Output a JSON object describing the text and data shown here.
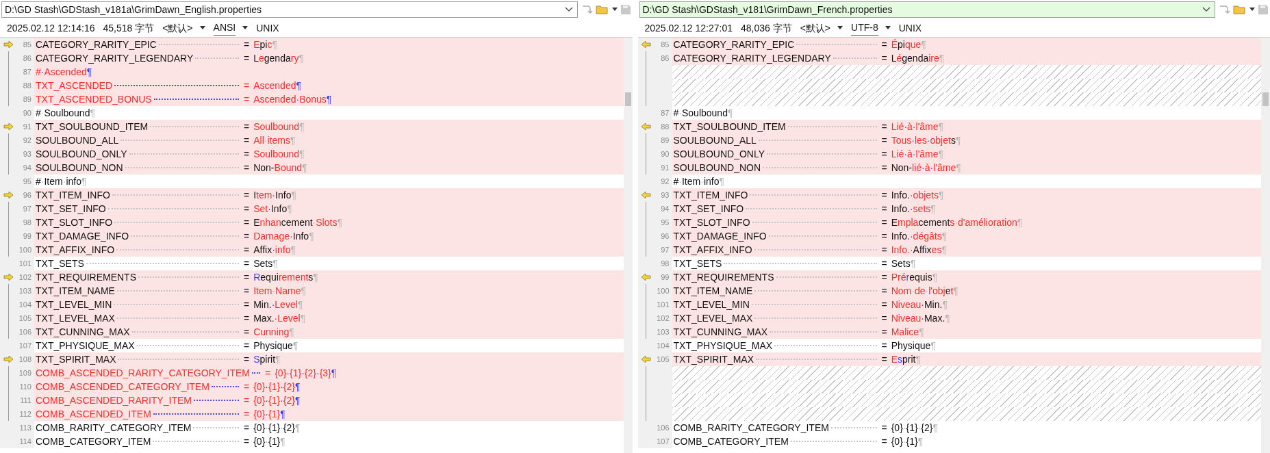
{
  "panes": [
    {
      "path": "D:\\GD Stash\\GDStash_v181a\\GrimDawn_English.properties",
      "path_highlighted": false,
      "date": "2025.02.12 12:14:16",
      "size": "45,518 字节",
      "codepage": "<默认>",
      "encoding": "ANSI",
      "encoding_highlighted": true,
      "eol": "UNIX",
      "lines": [
        {
          "kind": "changed",
          "arrow": true,
          "number": "85",
          "key": [
            {
              "text": "CATEGORY_RARITY_EPIC",
              "kind": "plain"
            }
          ],
          "value": [
            {
              "text": "=",
              "kind": "plain"
            },
            {
              "text": "E",
              "kind": "changed"
            },
            {
              "text": "pi",
              "kind": "plain"
            },
            {
              "text": "c",
              "kind": "changed"
            },
            {
              "text": "¶",
              "kind": "marker"
            }
          ]
        },
        {
          "kind": "changed",
          "arrow": false,
          "number": "86",
          "key": [
            {
              "text": "CATEGORY_RARITY_LEGENDARY",
              "kind": "plain"
            }
          ],
          "value": [
            {
              "text": "=",
              "kind": "plain"
            },
            {
              "text": "L",
              "kind": "plain"
            },
            {
              "text": "e",
              "kind": "changed"
            },
            {
              "text": "genda",
              "kind": "plain"
            },
            {
              "text": "ry",
              "kind": "changed"
            },
            {
              "text": "¶",
              "kind": "marker"
            }
          ]
        },
        {
          "kind": "added",
          "arrow": false,
          "number": "87",
          "key": [
            {
              "text": "#",
              "kind": "changed"
            },
            {
              "text": "·",
              "kind": "moved"
            },
            {
              "text": "Ascended",
              "kind": "changed"
            },
            {
              "text": "¶",
              "kind": "moved"
            }
          ]
        },
        {
          "kind": "added",
          "arrow": false,
          "number": "88",
          "key": [
            {
              "text": "TXT_ASCENDED",
              "kind": "changed"
            }
          ],
          "value": [
            {
              "text": "=",
              "kind": "changed"
            },
            {
              "text": "Ascended",
              "kind": "changed"
            },
            {
              "text": "¶",
              "kind": "moved"
            }
          ]
        },
        {
          "kind": "added",
          "arrow": false,
          "number": "89",
          "key": [
            {
              "text": "TXT_ASCENDED_BONUS",
              "kind": "changed"
            }
          ],
          "value": [
            {
              "text": "=",
              "kind": "changed"
            },
            {
              "text": "Ascended",
              "kind": "changed"
            },
            {
              "text": "·",
              "kind": "moved"
            },
            {
              "text": "Bonus",
              "kind": "changed"
            },
            {
              "text": "¶",
              "kind": "moved"
            }
          ]
        },
        {
          "kind": "equal",
          "arrow": false,
          "number": "90",
          "key": [
            {
              "text": "#",
              "kind": "plain"
            },
            {
              "text": "·",
              "kind": "marker"
            },
            {
              "text": "Soulbound",
              "kind": "plain"
            },
            {
              "text": "¶",
              "kind": "marker"
            }
          ]
        },
        {
          "kind": "changed",
          "arrow": true,
          "number": "91",
          "key": [
            {
              "text": "TXT_SOULBOUND_ITEM",
              "kind": "plain"
            }
          ],
          "value": [
            {
              "text": "=",
              "kind": "plain"
            },
            {
              "text": "Soulbound",
              "kind": "changed"
            },
            {
              "text": "¶",
              "kind": "marker"
            }
          ]
        },
        {
          "kind": "changed",
          "arrow": false,
          "number": "92",
          "key": [
            {
              "text": "SOULBOUND_ALL",
              "kind": "plain"
            }
          ],
          "value": [
            {
              "text": "=",
              "kind": "plain"
            },
            {
              "text": "All",
              "kind": "changed"
            },
            {
              "text": "·",
              "kind": "marker"
            },
            {
              "text": "items",
              "kind": "changed"
            },
            {
              "text": "¶",
              "kind": "marker"
            }
          ]
        },
        {
          "kind": "changed",
          "arrow": false,
          "number": "93",
          "key": [
            {
              "text": "SOULBOUND_ONLY",
              "kind": "plain"
            }
          ],
          "value": [
            {
              "text": "=",
              "kind": "plain"
            },
            {
              "text": "Soulbound",
              "kind": "changed"
            },
            {
              "text": "¶",
              "kind": "marker"
            }
          ]
        },
        {
          "kind": "changed",
          "arrow": false,
          "number": "94",
          "key": [
            {
              "text": "SOULBOUND_NON",
              "kind": "plain"
            }
          ],
          "value": [
            {
              "text": "=",
              "kind": "plain"
            },
            {
              "text": "Non-",
              "kind": "plain"
            },
            {
              "text": "Bound",
              "kind": "changed"
            },
            {
              "text": "¶",
              "kind": "marker"
            }
          ]
        },
        {
          "kind": "equal",
          "arrow": false,
          "number": "95",
          "key": [
            {
              "text": "#",
              "kind": "plain"
            },
            {
              "text": "·",
              "kind": "marker"
            },
            {
              "text": "Item",
              "kind": "plain"
            },
            {
              "text": "·",
              "kind": "marker"
            },
            {
              "text": "info",
              "kind": "plain"
            },
            {
              "text": "¶",
              "kind": "marker"
            }
          ]
        },
        {
          "kind": "changed",
          "arrow": true,
          "number": "96",
          "key": [
            {
              "text": "TXT_ITEM_INFO",
              "kind": "plain"
            }
          ],
          "value": [
            {
              "text": "=",
              "kind": "plain"
            },
            {
              "text": "I",
              "kind": "plain"
            },
            {
              "text": "tem",
              "kind": "changed"
            },
            {
              "text": "·",
              "kind": "moved"
            },
            {
              "text": "Info",
              "kind": "plain"
            },
            {
              "text": "¶",
              "kind": "marker"
            }
          ]
        },
        {
          "kind": "changed",
          "arrow": false,
          "number": "97",
          "key": [
            {
              "text": "TXT_SET_INFO",
              "kind": "plain"
            }
          ],
          "value": [
            {
              "text": "=",
              "kind": "plain"
            },
            {
              "text": "Set",
              "kind": "changed"
            },
            {
              "text": "·",
              "kind": "moved"
            },
            {
              "text": "Info",
              "kind": "plain"
            },
            {
              "text": "¶",
              "kind": "marker"
            }
          ]
        },
        {
          "kind": "changed",
          "arrow": false,
          "number": "98",
          "key": [
            {
              "text": "TXT_SLOT_INFO",
              "kind": "plain"
            }
          ],
          "value": [
            {
              "text": "=",
              "kind": "plain"
            },
            {
              "text": "E",
              "kind": "plain"
            },
            {
              "text": "nhan",
              "kind": "changed"
            },
            {
              "text": "cement",
              "kind": "plain"
            },
            {
              "text": "·",
              "kind": "marker"
            },
            {
              "text": "Slots",
              "kind": "changed"
            },
            {
              "text": "¶",
              "kind": "marker"
            }
          ]
        },
        {
          "kind": "changed",
          "arrow": false,
          "number": "99",
          "key": [
            {
              "text": "TXT_DAMAGE_INFO",
              "kind": "plain"
            }
          ],
          "value": [
            {
              "text": "=",
              "kind": "plain"
            },
            {
              "text": "Damage",
              "kind": "changed"
            },
            {
              "text": "·",
              "kind": "moved"
            },
            {
              "text": "Info",
              "kind": "plain"
            },
            {
              "text": "¶",
              "kind": "marker"
            }
          ]
        },
        {
          "kind": "changed",
          "arrow": false,
          "number": "100",
          "key": [
            {
              "text": "TXT_AFFIX_INFO",
              "kind": "plain"
            }
          ],
          "value": [
            {
              "text": "=",
              "kind": "plain"
            },
            {
              "text": "Affix",
              "kind": "plain"
            },
            {
              "text": "·",
              "kind": "moved"
            },
            {
              "text": "info",
              "kind": "changed"
            },
            {
              "text": "¶",
              "kind": "marker"
            }
          ]
        },
        {
          "kind": "equal",
          "arrow": false,
          "number": "101",
          "key": [
            {
              "text": "TXT_SETS",
              "kind": "plain"
            }
          ],
          "value": [
            {
              "text": "=",
              "kind": "plain"
            },
            {
              "text": "Sets",
              "kind": "plain"
            },
            {
              "text": "¶",
              "kind": "marker"
            }
          ]
        },
        {
          "kind": "changed",
          "arrow": true,
          "number": "102",
          "key": [
            {
              "text": "TXT_REQUIREMENTS",
              "kind": "plain"
            }
          ],
          "value": [
            {
              "text": "=",
              "kind": "plain"
            },
            {
              "text": "R",
              "kind": "moved"
            },
            {
              "text": "equi",
              "kind": "plain"
            },
            {
              "text": "rement",
              "kind": "changed"
            },
            {
              "text": "s",
              "kind": "plain"
            },
            {
              "text": "¶",
              "kind": "marker"
            }
          ]
        },
        {
          "kind": "changed",
          "arrow": false,
          "number": "103",
          "key": [
            {
              "text": "TXT_ITEM_NAME",
              "kind": "plain"
            }
          ],
          "value": [
            {
              "text": "=",
              "kind": "plain"
            },
            {
              "text": "Item",
              "kind": "changed"
            },
            {
              "text": "·",
              "kind": "marker"
            },
            {
              "text": "Name",
              "kind": "changed"
            },
            {
              "text": "¶",
              "kind": "marker"
            }
          ]
        },
        {
          "kind": "changed",
          "arrow": false,
          "number": "104",
          "key": [
            {
              "text": "TXT_LEVEL_MIN",
              "kind": "plain"
            }
          ],
          "value": [
            {
              "text": "=",
              "kind": "plain"
            },
            {
              "text": "Min.",
              "kind": "plain"
            },
            {
              "text": "·",
              "kind": "moved"
            },
            {
              "text": "Level",
              "kind": "changed"
            },
            {
              "text": "¶",
              "kind": "marker"
            }
          ]
        },
        {
          "kind": "changed",
          "arrow": false,
          "number": "105",
          "key": [
            {
              "text": "TXT_LEVEL_MAX",
              "kind": "plain"
            }
          ],
          "value": [
            {
              "text": "=",
              "kind": "plain"
            },
            {
              "text": "Max.",
              "kind": "plain"
            },
            {
              "text": "·",
              "kind": "moved"
            },
            {
              "text": "Level",
              "kind": "changed"
            },
            {
              "text": "¶",
              "kind": "marker"
            }
          ]
        },
        {
          "kind": "changed",
          "arrow": false,
          "number": "106",
          "key": [
            {
              "text": "TXT_CUNNING_MAX",
              "kind": "plain"
            }
          ],
          "value": [
            {
              "text": "=",
              "kind": "plain"
            },
            {
              "text": "Cunning",
              "kind": "changed"
            },
            {
              "text": "¶",
              "kind": "marker"
            }
          ]
        },
        {
          "kind": "equal",
          "arrow": false,
          "number": "107",
          "key": [
            {
              "text": "TXT_PHYSIQUE_MAX",
              "kind": "plain"
            }
          ],
          "value": [
            {
              "text": "=",
              "kind": "plain"
            },
            {
              "text": "Physique",
              "kind": "plain"
            },
            {
              "text": "¶",
              "kind": "marker"
            }
          ]
        },
        {
          "kind": "changed",
          "arrow": true,
          "number": "108",
          "key": [
            {
              "text": "TXT_SPIRIT_MAX",
              "kind": "plain"
            }
          ],
          "value": [
            {
              "text": "=",
              "kind": "plain"
            },
            {
              "text": "S",
              "kind": "moved"
            },
            {
              "text": "pirit",
              "kind": "plain"
            },
            {
              "text": "¶",
              "kind": "marker"
            }
          ]
        },
        {
          "kind": "added",
          "arrow": false,
          "number": "109",
          "key": [
            {
              "text": "COMB_ASCENDED_RARITY_CATEGORY_ITEM",
              "kind": "changed"
            }
          ],
          "value": [
            {
              "text": "=",
              "kind": "changed"
            },
            {
              "text": "{0}",
              "kind": "changed"
            },
            {
              "text": "·",
              "kind": "moved"
            },
            {
              "text": "{1}",
              "kind": "changed"
            },
            {
              "text": "·",
              "kind": "moved"
            },
            {
              "text": "{2}",
              "kind": "changed"
            },
            {
              "text": "·",
              "kind": "moved"
            },
            {
              "text": "{3}",
              "kind": "changed"
            },
            {
              "text": "¶",
              "kind": "moved"
            }
          ]
        },
        {
          "kind": "added",
          "arrow": false,
          "number": "110",
          "key": [
            {
              "text": "COMB_ASCENDED_CATEGORY_ITEM",
              "kind": "changed"
            }
          ],
          "value": [
            {
              "text": "=",
              "kind": "changed"
            },
            {
              "text": "{0}",
              "kind": "changed"
            },
            {
              "text": "·",
              "kind": "moved"
            },
            {
              "text": "{1}",
              "kind": "changed"
            },
            {
              "text": "·",
              "kind": "moved"
            },
            {
              "text": "{2}",
              "kind": "changed"
            },
            {
              "text": "¶",
              "kind": "moved"
            }
          ]
        },
        {
          "kind": "added",
          "arrow": false,
          "number": "111",
          "key": [
            {
              "text": "COMB_ASCENDED_RARITY_ITEM",
              "kind": "changed"
            }
          ],
          "value": [
            {
              "text": "=",
              "kind": "changed"
            },
            {
              "text": "{0}",
              "kind": "changed"
            },
            {
              "text": "·",
              "kind": "moved"
            },
            {
              "text": "{1}",
              "kind": "changed"
            },
            {
              "text": "·",
              "kind": "moved"
            },
            {
              "text": "{2}",
              "kind": "changed"
            },
            {
              "text": "¶",
              "kind": "moved"
            }
          ]
        },
        {
          "kind": "added",
          "arrow": false,
          "number": "112",
          "key": [
            {
              "text": "COMB_ASCENDED_ITEM",
              "kind": "changed"
            }
          ],
          "value": [
            {
              "text": "=",
              "kind": "changed"
            },
            {
              "text": "{0}",
              "kind": "changed"
            },
            {
              "text": "·",
              "kind": "moved"
            },
            {
              "text": "{1}",
              "kind": "changed"
            },
            {
              "text": "¶",
              "kind": "moved"
            }
          ]
        },
        {
          "kind": "equal",
          "arrow": false,
          "number": "113",
          "key": [
            {
              "text": "COMB_RARITY_CATEGORY_ITEM",
              "kind": "plain"
            }
          ],
          "value": [
            {
              "text": "=",
              "kind": "plain"
            },
            {
              "text": "{0}",
              "kind": "plain"
            },
            {
              "text": "·",
              "kind": "marker"
            },
            {
              "text": "{1}",
              "kind": "plain"
            },
            {
              "text": "·",
              "kind": "marker"
            },
            {
              "text": "{2}",
              "kind": "plain"
            },
            {
              "text": "¶",
              "kind": "marker"
            }
          ]
        },
        {
          "kind": "equal",
          "arrow": false,
          "number": "114",
          "key": [
            {
              "text": "COMB_CATEGORY_ITEM",
              "kind": "plain"
            }
          ],
          "value": [
            {
              "text": "=",
              "kind": "plain"
            },
            {
              "text": "{0}",
              "kind": "plain"
            },
            {
              "text": "·",
              "kind": "marker"
            },
            {
              "text": "{1}",
              "kind": "plain"
            },
            {
              "text": "¶",
              "kind": "marker"
            }
          ]
        }
      ]
    },
    {
      "path": "D:\\GD Stash\\GDStash_v181\\GrimDawn_French.properties",
      "path_highlighted": true,
      "date": "2025.02.12 12:27:01",
      "size": "48,036 字节",
      "codepage": "<默认>",
      "encoding": "UTF-8",
      "encoding_highlighted": true,
      "eol": "UNIX",
      "lines": [
        {
          "kind": "changed",
          "arrow": true,
          "number": "85",
          "key": [
            {
              "text": "CATEGORY_RARITY_EPIC",
              "kind": "plain"
            }
          ],
          "value": [
            {
              "text": "=",
              "kind": "plain"
            },
            {
              "text": "É",
              "kind": "changed"
            },
            {
              "text": "pi",
              "kind": "plain"
            },
            {
              "text": "que",
              "kind": "changed"
            },
            {
              "text": "¶",
              "kind": "marker"
            }
          ]
        },
        {
          "kind": "changed",
          "arrow": false,
          "number": "86",
          "key": [
            {
              "text": "CATEGORY_RARITY_LEGENDARY",
              "kind": "plain"
            }
          ],
          "value": [
            {
              "text": "=",
              "kind": "plain"
            },
            {
              "text": "L",
              "kind": "plain"
            },
            {
              "text": "é",
              "kind": "changed"
            },
            {
              "text": "genda",
              "kind": "plain"
            },
            {
              "text": "ire",
              "kind": "changed"
            },
            {
              "text": "¶",
              "kind": "marker"
            }
          ]
        },
        {
          "kind": "ghost",
          "arrow": false
        },
        {
          "kind": "ghost",
          "arrow": false
        },
        {
          "kind": "ghost",
          "arrow": false
        },
        {
          "kind": "equal",
          "arrow": false,
          "number": "87",
          "key": [
            {
              "text": "#",
              "kind": "plain"
            },
            {
              "text": "·",
              "kind": "marker"
            },
            {
              "text": "Soulbound",
              "kind": "plain"
            },
            {
              "text": "¶",
              "kind": "marker"
            }
          ]
        },
        {
          "kind": "changed",
          "arrow": true,
          "number": "88",
          "key": [
            {
              "text": "TXT_SOULBOUND_ITEM",
              "kind": "plain"
            }
          ],
          "value": [
            {
              "text": "=",
              "kind": "plain"
            },
            {
              "text": "Lié",
              "kind": "changed"
            },
            {
              "text": "·",
              "kind": "moved"
            },
            {
              "text": "à",
              "kind": "changed"
            },
            {
              "text": "·",
              "kind": "moved"
            },
            {
              "text": "l'âme",
              "kind": "changed"
            },
            {
              "text": "¶",
              "kind": "marker"
            }
          ]
        },
        {
          "kind": "changed",
          "arrow": false,
          "number": "89",
          "key": [
            {
              "text": "SOULBOUND_ALL",
              "kind": "plain"
            }
          ],
          "value": [
            {
              "text": "=",
              "kind": "plain"
            },
            {
              "text": "Tous",
              "kind": "changed"
            },
            {
              "text": "·",
              "kind": "moved"
            },
            {
              "text": "les",
              "kind": "changed"
            },
            {
              "text": "·",
              "kind": "moved"
            },
            {
              "text": "objet",
              "kind": "changed"
            },
            {
              "text": "s",
              "kind": "plain"
            },
            {
              "text": "¶",
              "kind": "marker"
            }
          ]
        },
        {
          "kind": "changed",
          "arrow": false,
          "number": "90",
          "key": [
            {
              "text": "SOULBOUND_ONLY",
              "kind": "plain"
            }
          ],
          "value": [
            {
              "text": "=",
              "kind": "plain"
            },
            {
              "text": "Lié",
              "kind": "changed"
            },
            {
              "text": "·",
              "kind": "moved"
            },
            {
              "text": "à",
              "kind": "changed"
            },
            {
              "text": "·",
              "kind": "moved"
            },
            {
              "text": "l'âme",
              "kind": "changed"
            },
            {
              "text": "¶",
              "kind": "marker"
            }
          ]
        },
        {
          "kind": "changed",
          "arrow": false,
          "number": "91",
          "key": [
            {
              "text": "SOULBOUND_NON",
              "kind": "plain"
            }
          ],
          "value": [
            {
              "text": "=",
              "kind": "plain"
            },
            {
              "text": "Non-",
              "kind": "plain"
            },
            {
              "text": "lié",
              "kind": "changed"
            },
            {
              "text": "·",
              "kind": "moved"
            },
            {
              "text": "à",
              "kind": "changed"
            },
            {
              "text": "·",
              "kind": "moved"
            },
            {
              "text": "l'âme",
              "kind": "changed"
            },
            {
              "text": "¶",
              "kind": "marker"
            }
          ]
        },
        {
          "kind": "equal",
          "arrow": false,
          "number": "92",
          "key": [
            {
              "text": "#",
              "kind": "plain"
            },
            {
              "text": "·",
              "kind": "marker"
            },
            {
              "text": "Item",
              "kind": "plain"
            },
            {
              "text": "·",
              "kind": "marker"
            },
            {
              "text": "info",
              "kind": "plain"
            },
            {
              "text": "¶",
              "kind": "marker"
            }
          ]
        },
        {
          "kind": "changed",
          "arrow": true,
          "number": "93",
          "key": [
            {
              "text": "TXT_ITEM_INFO",
              "kind": "plain"
            }
          ],
          "value": [
            {
              "text": "=",
              "kind": "plain"
            },
            {
              "text": "Info.",
              "kind": "plain"
            },
            {
              "text": "·",
              "kind": "moved"
            },
            {
              "text": "objets",
              "kind": "changed"
            },
            {
              "text": "¶",
              "kind": "marker"
            }
          ]
        },
        {
          "kind": "changed",
          "arrow": false,
          "number": "94",
          "key": [
            {
              "text": "TXT_SET_INFO",
              "kind": "plain"
            }
          ],
          "value": [
            {
              "text": "=",
              "kind": "plain"
            },
            {
              "text": "Info.",
              "kind": "plain"
            },
            {
              "text": "·",
              "kind": "moved"
            },
            {
              "text": "sets",
              "kind": "changed"
            },
            {
              "text": "¶",
              "kind": "marker"
            }
          ]
        },
        {
          "kind": "changed",
          "arrow": false,
          "number": "95",
          "key": [
            {
              "text": "TXT_SLOT_INFO",
              "kind": "plain"
            }
          ],
          "value": [
            {
              "text": "=",
              "kind": "plain"
            },
            {
              "text": "E",
              "kind": "plain"
            },
            {
              "text": "mpla",
              "kind": "changed"
            },
            {
              "text": "cement",
              "kind": "plain"
            },
            {
              "text": "s",
              "kind": "changed"
            },
            {
              "text": "·",
              "kind": "marker"
            },
            {
              "text": "d'amélioration",
              "kind": "changed"
            },
            {
              "text": "¶",
              "kind": "marker"
            }
          ]
        },
        {
          "kind": "changed",
          "arrow": false,
          "number": "96",
          "key": [
            {
              "text": "TXT_DAMAGE_INFO",
              "kind": "plain"
            }
          ],
          "value": [
            {
              "text": "=",
              "kind": "plain"
            },
            {
              "text": "Info.",
              "kind": "plain"
            },
            {
              "text": "·",
              "kind": "moved"
            },
            {
              "text": "dégâts",
              "kind": "changed"
            },
            {
              "text": "¶",
              "kind": "marker"
            }
          ]
        },
        {
          "kind": "changed",
          "arrow": false,
          "number": "97",
          "key": [
            {
              "text": "TXT_AFFIX_INFO",
              "kind": "plain"
            }
          ],
          "value": [
            {
              "text": "=",
              "kind": "plain"
            },
            {
              "text": "Info.",
              "kind": "changed"
            },
            {
              "text": "·",
              "kind": "moved"
            },
            {
              "text": "Affix",
              "kind": "plain"
            },
            {
              "text": "es",
              "kind": "changed"
            },
            {
              "text": "¶",
              "kind": "marker"
            }
          ]
        },
        {
          "kind": "equal",
          "arrow": false,
          "number": "98",
          "key": [
            {
              "text": "TXT_SETS",
              "kind": "plain"
            }
          ],
          "value": [
            {
              "text": "=",
              "kind": "plain"
            },
            {
              "text": "Sets",
              "kind": "plain"
            },
            {
              "text": "¶",
              "kind": "marker"
            }
          ]
        },
        {
          "kind": "changed",
          "arrow": true,
          "number": "99",
          "key": [
            {
              "text": "TXT_REQUIREMENTS",
              "kind": "plain"
            }
          ],
          "value": [
            {
              "text": "=",
              "kind": "plain"
            },
            {
              "text": "Pré",
              "kind": "changed"
            },
            {
              "text": "r",
              "kind": "moved"
            },
            {
              "text": "equis",
              "kind": "plain"
            },
            {
              "text": "¶",
              "kind": "marker"
            }
          ]
        },
        {
          "kind": "changed",
          "arrow": false,
          "number": "100",
          "key": [
            {
              "text": "TXT_ITEM_NAME",
              "kind": "plain"
            }
          ],
          "value": [
            {
              "text": "=",
              "kind": "plain"
            },
            {
              "text": "Nom",
              "kind": "changed"
            },
            {
              "text": "·",
              "kind": "marker"
            },
            {
              "text": "de",
              "kind": "changed"
            },
            {
              "text": "·",
              "kind": "marker"
            },
            {
              "text": "l'obj",
              "kind": "changed"
            },
            {
              "text": "e",
              "kind": "plain"
            },
            {
              "text": "t",
              "kind": "changed"
            },
            {
              "text": "¶",
              "kind": "marker"
            }
          ]
        },
        {
          "kind": "changed",
          "arrow": false,
          "number": "101",
          "key": [
            {
              "text": "TXT_LEVEL_MIN",
              "kind": "plain"
            }
          ],
          "value": [
            {
              "text": "=",
              "kind": "plain"
            },
            {
              "text": "Niveau",
              "kind": "changed"
            },
            {
              "text": "·",
              "kind": "moved"
            },
            {
              "text": "Min.",
              "kind": "plain"
            },
            {
              "text": "¶",
              "kind": "marker"
            }
          ]
        },
        {
          "kind": "changed",
          "arrow": false,
          "number": "102",
          "key": [
            {
              "text": "TXT_LEVEL_MAX",
              "kind": "plain"
            }
          ],
          "value": [
            {
              "text": "=",
              "kind": "plain"
            },
            {
              "text": "Niveau",
              "kind": "changed"
            },
            {
              "text": "·",
              "kind": "moved"
            },
            {
              "text": "Max.",
              "kind": "plain"
            },
            {
              "text": "¶",
              "kind": "marker"
            }
          ]
        },
        {
          "kind": "changed",
          "arrow": false,
          "number": "103",
          "key": [
            {
              "text": "TXT_CUNNING_MAX",
              "kind": "plain"
            }
          ],
          "value": [
            {
              "text": "=",
              "kind": "plain"
            },
            {
              "text": "Malice",
              "kind": "changed"
            },
            {
              "text": "¶",
              "kind": "marker"
            }
          ]
        },
        {
          "kind": "equal",
          "arrow": false,
          "number": "104",
          "key": [
            {
              "text": "TXT_PHYSIQUE_MAX",
              "kind": "plain"
            }
          ],
          "value": [
            {
              "text": "=",
              "kind": "plain"
            },
            {
              "text": "Physique",
              "kind": "plain"
            },
            {
              "text": "¶",
              "kind": "marker"
            }
          ]
        },
        {
          "kind": "changed",
          "arrow": true,
          "number": "105",
          "key": [
            {
              "text": "TXT_SPIRIT_MAX",
              "kind": "plain"
            }
          ],
          "value": [
            {
              "text": "=",
              "kind": "plain"
            },
            {
              "text": "E",
              "kind": "changed"
            },
            {
              "text": "s",
              "kind": "moved"
            },
            {
              "text": "prit",
              "kind": "plain"
            },
            {
              "text": "¶",
              "kind": "marker"
            }
          ]
        },
        {
          "kind": "ghost",
          "arrow": false
        },
        {
          "kind": "ghost",
          "arrow": false
        },
        {
          "kind": "ghost",
          "arrow": false
        },
        {
          "kind": "ghost",
          "arrow": false
        },
        {
          "kind": "equal",
          "arrow": false,
          "number": "106",
          "key": [
            {
              "text": "COMB_RARITY_CATEGORY_ITEM",
              "kind": "plain"
            }
          ],
          "value": [
            {
              "text": "=",
              "kind": "plain"
            },
            {
              "text": "{0}",
              "kind": "plain"
            },
            {
              "text": "·",
              "kind": "marker"
            },
            {
              "text": "{1}",
              "kind": "plain"
            },
            {
              "text": "·",
              "kind": "marker"
            },
            {
              "text": "{2}",
              "kind": "plain"
            },
            {
              "text": "¶",
              "kind": "marker"
            }
          ]
        },
        {
          "kind": "equal",
          "arrow": false,
          "number": "107",
          "key": [
            {
              "text": "COMB_CATEGORY_ITEM",
              "kind": "plain"
            }
          ],
          "value": [
            {
              "text": "=",
              "kind": "plain"
            },
            {
              "text": "{0}",
              "kind": "plain"
            },
            {
              "text": "·",
              "kind": "marker"
            },
            {
              "text": "{1}",
              "kind": "plain"
            },
            {
              "text": "¶",
              "kind": "marker"
            }
          ]
        }
      ]
    }
  ]
}
